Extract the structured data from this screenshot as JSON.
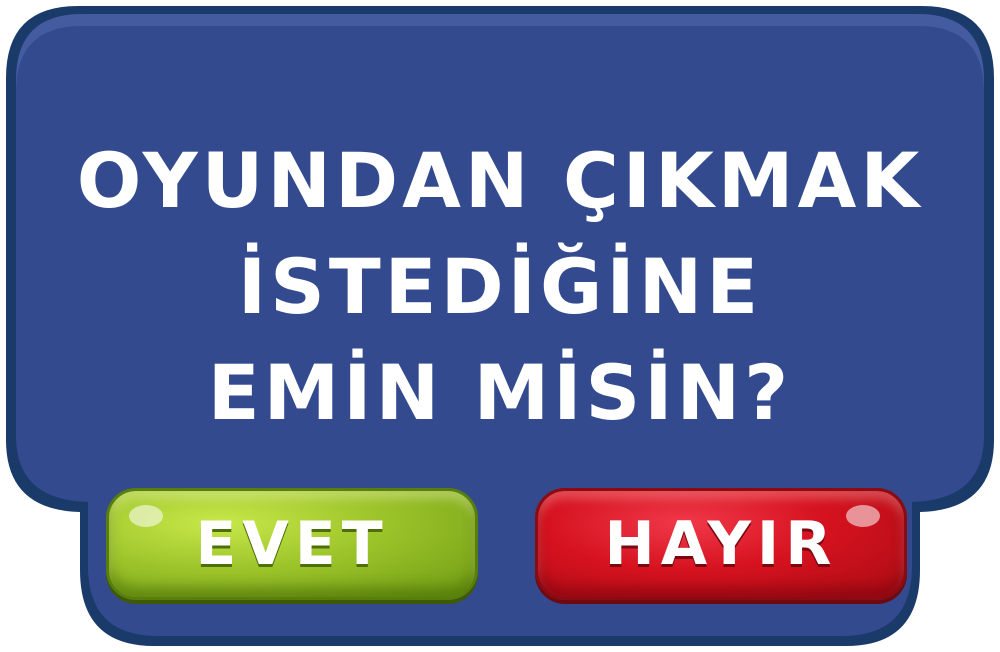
{
  "dialog": {
    "question_lines": [
      "OYUNDAN ÇIKMAK",
      "İSTEDİĞİNE",
      "EMİN MİSİN?"
    ]
  },
  "buttons": {
    "yes_label": "EVET",
    "no_label": "HAYIR"
  },
  "colors": {
    "panel_fill": "#334a8f",
    "panel_border": "#1a3a6a",
    "yes_button": "#9cc42a",
    "no_button": "#d6121f",
    "text": "#ffffff"
  }
}
